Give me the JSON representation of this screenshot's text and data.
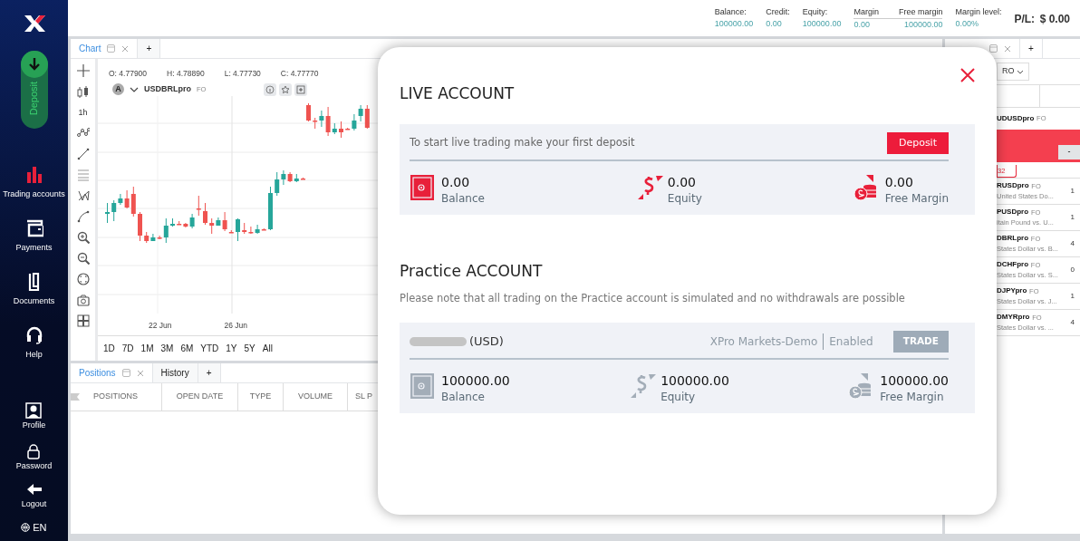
{
  "sidebar": {
    "deposit": "Deposit",
    "items": [
      {
        "label": "Trading accounts",
        "selected": true
      },
      {
        "label": "Payments",
        "selected": false
      },
      {
        "label": "Documents",
        "selected": false
      },
      {
        "label": "Help",
        "selected": false
      }
    ],
    "bottom_items": [
      {
        "label": "Profile"
      },
      {
        "label": "Password"
      },
      {
        "label": "Logout"
      }
    ],
    "language": "EN"
  },
  "account_summary": {
    "items": [
      {
        "label": "Balance:",
        "value": "100000.00"
      },
      {
        "label": "Credit:",
        "value": "0.00"
      },
      {
        "label": "Equity:",
        "value": "100000.00"
      },
      {
        "label": "Margin",
        "value": "0.00"
      },
      {
        "label": "Free margin",
        "value": "100000.00"
      },
      {
        "label": "Margin level:",
        "value": "0.00%"
      }
    ],
    "pl_label": "P/L:",
    "pl_value": "$ 0.00"
  },
  "chart_panel": {
    "tabs": [
      {
        "label": "Chart",
        "selected": true
      },
      {
        "label": "+",
        "selected": false
      }
    ],
    "interval": "1h",
    "ohlc": [
      "O: 4.77900",
      "H: 4.78890",
      "L: 4.77730",
      "C: 4.77770"
    ],
    "symbol_badge": "A",
    "symbol": "USDBRLpro",
    "symbol_tag": "FO",
    "x_labels": [
      "22 Jun",
      "26 Jun"
    ],
    "periods": [
      "1D",
      "7D",
      "1M",
      "3M",
      "6M",
      "YTD",
      "1Y",
      "5Y",
      "All"
    ]
  },
  "positions_panel": {
    "tabs": [
      {
        "label": "Positions",
        "selected": true
      },
      {
        "label": "History",
        "selected": false
      },
      {
        "label": "+",
        "selected": false
      }
    ],
    "columns": [
      "POSITIONS",
      "OPEN DATE",
      "TYPE",
      "VOLUME",
      "SL P"
    ]
  },
  "market_panel": {
    "tabs": [
      {
        "label": "+"
      }
    ],
    "filter": "RO",
    "featured_symbol": "UDUSDpro",
    "featured_tag": "FO",
    "minus": "-",
    "spread": "32",
    "rows": [
      {
        "symbol": "RUSDpro",
        "tag": "FO",
        "description": "United States Do...",
        "price": "1"
      },
      {
        "symbol": "PUSDpro",
        "tag": "FO",
        "description": "itain Pound vs. U...",
        "price": "1"
      },
      {
        "symbol": "DBRLpro",
        "tag": "FO",
        "description": "States Dollar vs. B...",
        "price": "4"
      },
      {
        "symbol": "DCHFpro",
        "tag": "FO",
        "description": "States Dollar vs. S...",
        "price": "0"
      },
      {
        "symbol": "DJPYpro",
        "tag": "FO",
        "description": "States Dollar vs. J...",
        "price": "1"
      },
      {
        "symbol": "DMYRpro",
        "tag": "FO",
        "description": "States Dollar vs. ...",
        "price": "4"
      }
    ]
  },
  "modal": {
    "live": {
      "title": "LIVE ACCOUNT",
      "message": "To start live trading make your first deposit",
      "button": "Deposit",
      "stats": [
        {
          "value": "0.00",
          "label": "Balance"
        },
        {
          "value": "0.00",
          "label": "Equity"
        },
        {
          "value": "0.00",
          "label": "Free Margin"
        }
      ]
    },
    "practice": {
      "title": "Practice ACCOUNT",
      "note": "Please note that all trading on the Practice account is simulated and no withdrawals are possible",
      "currency": "(USD)",
      "server": "XPro Markets-Demo",
      "status": "Enabled",
      "button": "TRADE",
      "stats": [
        {
          "value": "100000.00",
          "label": "Balance"
        },
        {
          "value": "100000.00",
          "label": "Equity"
        },
        {
          "value": "100000.00",
          "label": "Free Margin"
        }
      ]
    }
  }
}
